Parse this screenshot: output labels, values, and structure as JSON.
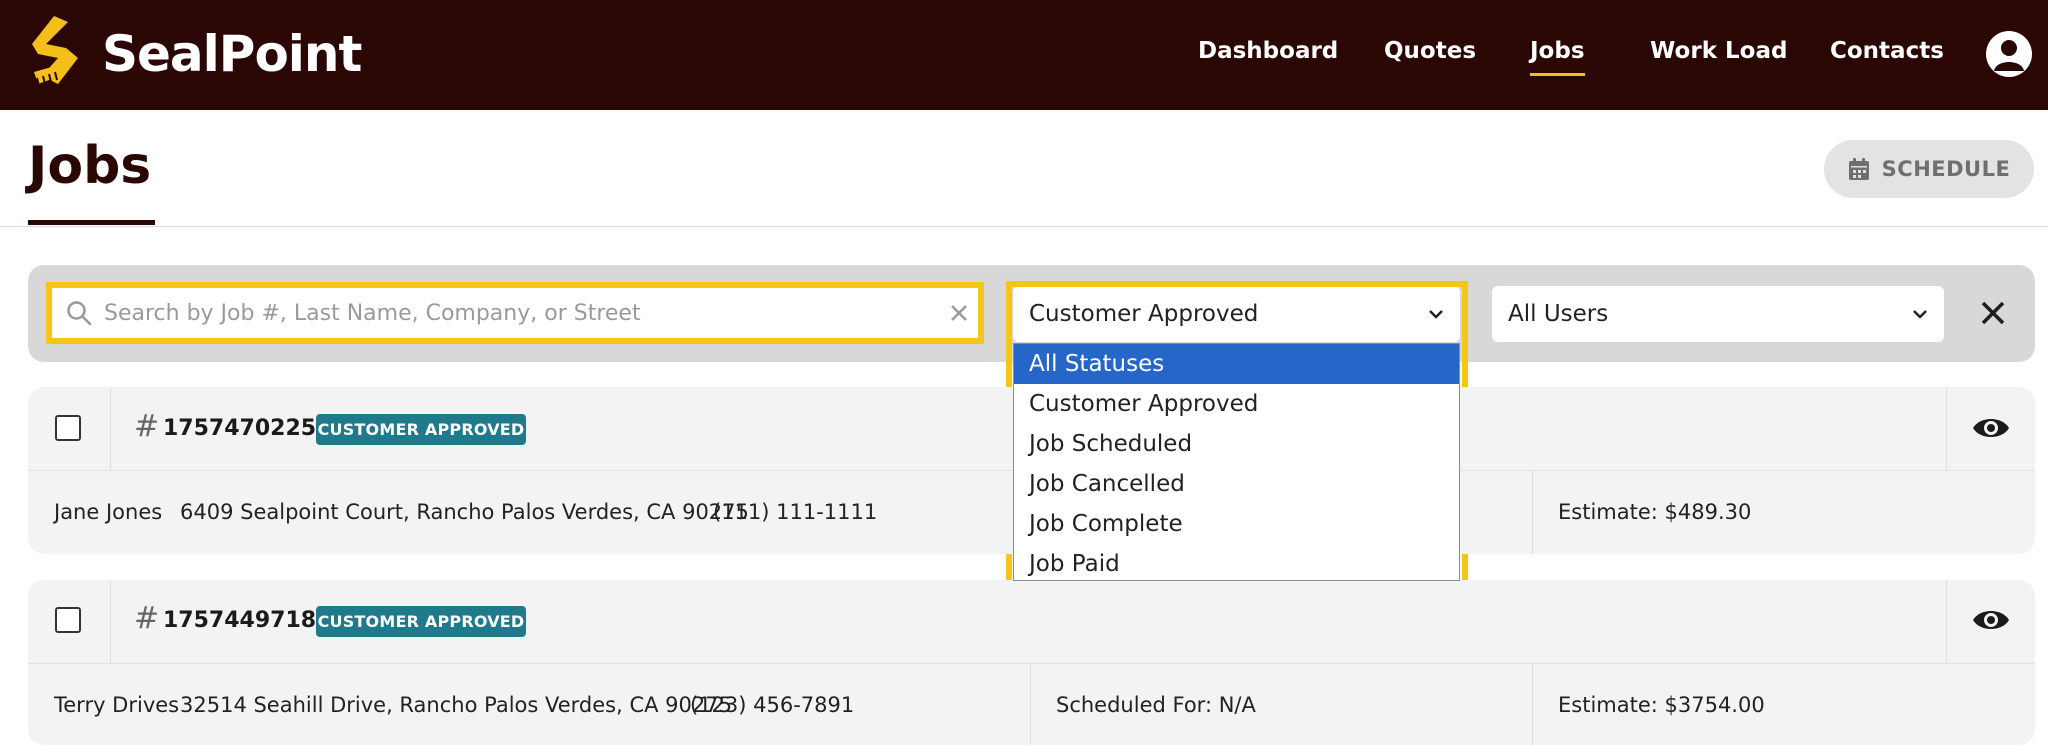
{
  "brand": {
    "name": "SealPoint"
  },
  "nav": {
    "links": [
      "Dashboard",
      "Quotes",
      "Jobs",
      "Work Load",
      "Contacts"
    ],
    "active": "Jobs"
  },
  "page": {
    "title": "Jobs",
    "schedule_label": "SCHEDULE"
  },
  "filters": {
    "search_placeholder": "Search by Job #, Last Name, Company, or Street",
    "search_value": "",
    "status_selected": "Customer Approved",
    "user_selected": "All Users",
    "status_options": [
      "All Statuses",
      "Customer Approved",
      "Job Scheduled",
      "Job Cancelled",
      "Job Complete",
      "Job Paid"
    ],
    "highlighted_option": "All Statuses"
  },
  "jobs": [
    {
      "number": "1757470225",
      "status": "CUSTOMER APPROVED",
      "name": "Jane Jones",
      "address": "6409 Sealpoint Court, Rancho Palos Verdes, CA 90275",
      "phone": "(111) 111-1111",
      "scheduled": "",
      "estimate": "Estimate: $489.30"
    },
    {
      "number": "1757449718",
      "status": "CUSTOMER APPROVED",
      "name": "Terry Drives",
      "address": "32514 Seahill Drive, Rancho Palos Verdes, CA 90275",
      "phone": "(123) 456-7891",
      "scheduled": "Scheduled For: N/A",
      "estimate": "Estimate: $3754.00"
    }
  ],
  "colors": {
    "nav_bg": "#2a0605",
    "accent": "#f5bf1a",
    "badge": "#1f7a8c",
    "highlight": "#f5c518",
    "selected_option": "#2566c8"
  }
}
